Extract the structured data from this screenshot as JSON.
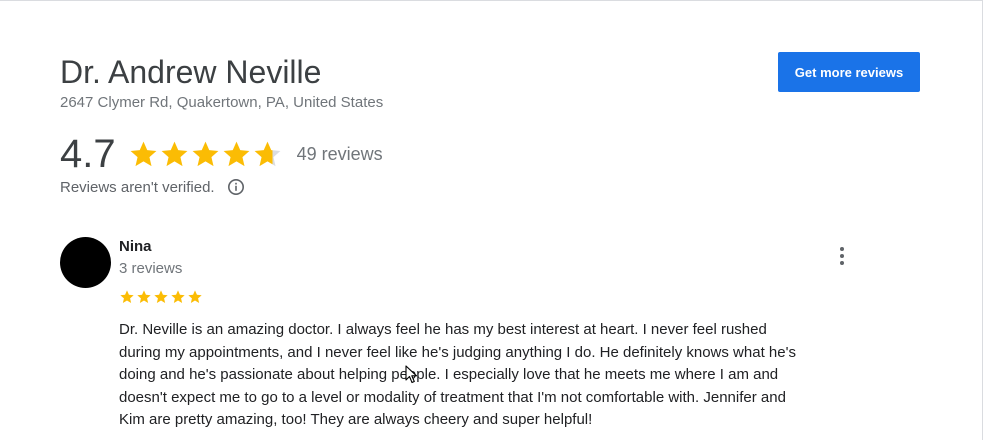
{
  "business": {
    "name": "Dr. Andrew Neville",
    "address": "2647 Clymer Rd, Quakertown, PA, United States"
  },
  "actions": {
    "get_more_reviews_label": "Get more reviews"
  },
  "summary": {
    "rating_text": "4.7",
    "rating_value": 4.7,
    "stars_total": 5,
    "review_count_text": "49 reviews",
    "verification_notice": "Reviews aren't verified.",
    "info_icon": "info-circle-icon"
  },
  "review": {
    "reviewer_name": "Nina",
    "reviewer_reviews_text": "3 reviews",
    "rating": 5,
    "text": "Dr. Neville is an amazing doctor.  I always feel he has my best interest at heart.  I never feel rushed\nduring my appointments, and I never feel like he's judging anything I do.  He definitely knows what he's\ndoing and he's passionate about helping people.  I especially love that he meets me where I am and\ndoesn't expect me to go to a level or modality of treatment that I'm not comfortable with.  Jennifer and\nKim are pretty amazing, too!  They are always cheery and super helpful!",
    "more_icon": "more-vertical-icon"
  },
  "colors": {
    "star_filled": "#fbbc04",
    "star_empty": "#dadce0",
    "accent": "#1a73e8"
  }
}
